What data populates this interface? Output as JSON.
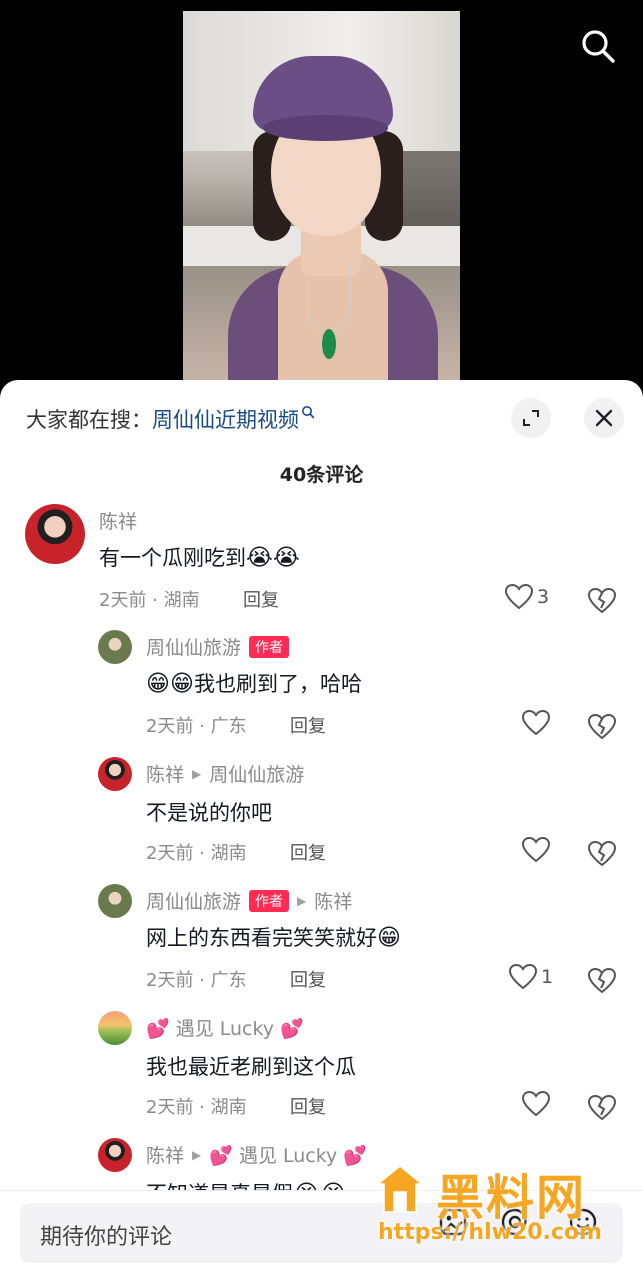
{
  "search_hint": {
    "prefix": "大家都在搜：",
    "keyword": "周仙仙近期视频"
  },
  "comment_count": "40条评论",
  "comments": [
    {
      "name": "陈祥",
      "text": "有一个瓜刚吃到",
      "emoji": "😭😭",
      "meta": "2天前 · 湖南",
      "reply": "回复",
      "likes": "3"
    },
    {
      "name": "周仙仙旅游",
      "badge": "作者",
      "emoji": "😁😁",
      "text": "我也刷到了，哈哈",
      "meta": "2天前 · 广东",
      "reply": "回复",
      "likes": ""
    },
    {
      "name": "陈祥",
      "reply_to": "周仙仙旅游",
      "text": "不是说的你吧",
      "meta": "2天前 · 湖南",
      "reply": "回复",
      "likes": ""
    },
    {
      "name": "周仙仙旅游",
      "badge": "作者",
      "reply_to": "陈祥",
      "text": "网上的东西看完笑笑就好",
      "emoji": "😁",
      "meta": "2天前 · 广东",
      "reply": "回复",
      "likes": "1"
    },
    {
      "name": "💕 遇见 Lucky 💕",
      "text": "我也最近老刷到这个瓜",
      "meta": "2天前 · 湖南",
      "reply": "回复",
      "likes": ""
    },
    {
      "name": "陈祥",
      "reply_to": "💕 遇见 Lucky 💕",
      "text": "不知道是真是假",
      "emoji": "😭😭"
    }
  ],
  "input": {
    "placeholder": "期待你的评论"
  },
  "watermark": {
    "title": "黑料网",
    "url": "https://hlw20.com"
  },
  "colors": {
    "author_badge": "#fe2c55",
    "keyword": "#1b4a8a",
    "watermark": "#f5a623"
  }
}
